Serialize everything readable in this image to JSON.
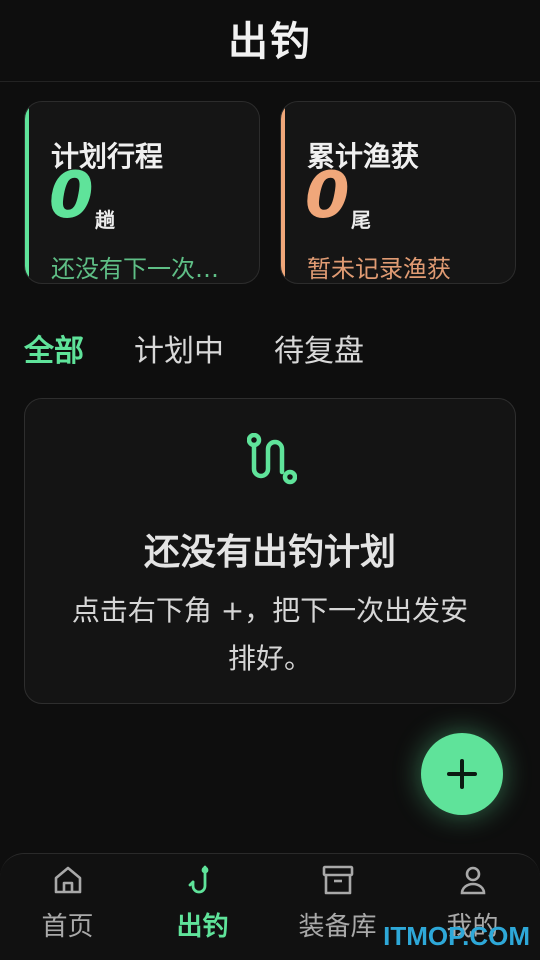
{
  "header": {
    "title": "出钓"
  },
  "stats": {
    "plan": {
      "label": "计划行程",
      "value": "0",
      "unit": "趟",
      "sub": "还没有下一次…",
      "color": "#5fe39a",
      "sub_color": "#5fbf86"
    },
    "catch": {
      "label": "累计渔获",
      "value": "0",
      "unit": "尾",
      "sub": "暂未记录渔获",
      "color": "#f0a77a",
      "sub_color": "#e09b73"
    }
  },
  "tabs": [
    {
      "label": "全部",
      "active": true
    },
    {
      "label": "计划中"
    },
    {
      "label": "待复盘"
    }
  ],
  "empty": {
    "icon": "route-icon",
    "title": "还没有出钓计划",
    "desc": "点击右下角 +，把下一次出发安排好。"
  },
  "fab": {
    "icon": "plus-icon"
  },
  "nav": [
    {
      "label": "首页",
      "icon": "home-icon"
    },
    {
      "label": "出钓",
      "icon": "fishhook-icon",
      "active": true
    },
    {
      "label": "装备库",
      "icon": "archive-icon"
    },
    {
      "label": "我的",
      "icon": "user-icon"
    }
  ],
  "watermark": "ITMOP.COM",
  "colors": {
    "accent": "#5fe39a",
    "warm": "#f0a77a",
    "background": "#0e0e0e"
  }
}
